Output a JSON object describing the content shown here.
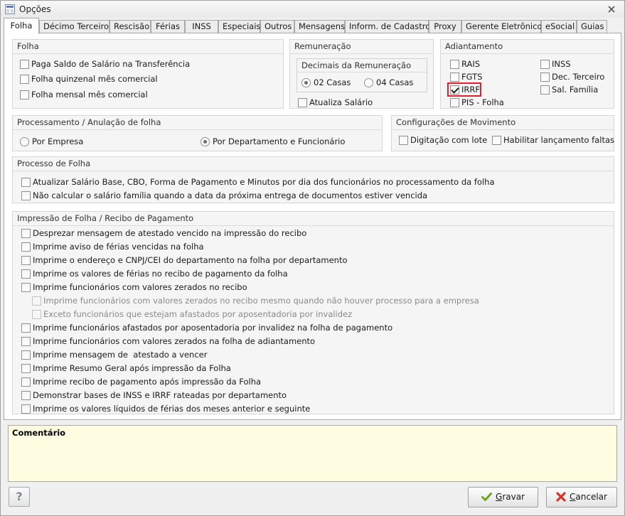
{
  "window": {
    "title": "Opções"
  },
  "tabs": [
    "Folha",
    "Décimo Terceiro",
    "Rescisão",
    "Férias",
    "INSS",
    "Especiais",
    "Outros",
    "Mensagens",
    "Inform. de Cadastro",
    "Proxy",
    "Gerente Eletrônico",
    "eSocial",
    "Guias"
  ],
  "active_tab": "Folha",
  "folha": {
    "title": "Folha",
    "options": [
      {
        "label": "Paga Saldo de Salário na Transferência",
        "checked": false
      },
      {
        "label": "Folha quinzenal mês comercial",
        "checked": false
      },
      {
        "label": "Folha mensal mês comercial",
        "checked": false
      }
    ]
  },
  "remuneracao": {
    "title": "Remuneração",
    "decimais_title": "Decimais da Remuneração",
    "radio_02": "02 Casas",
    "radio_04": "04 Casas",
    "selected": "02 Casas",
    "atualiza_salario": "Atualiza Salário"
  },
  "adiantamento": {
    "title": "Adiantamento",
    "left": [
      {
        "label": "RAIS",
        "checked": false
      },
      {
        "label": "FGTS",
        "checked": false
      },
      {
        "label": "IRRF",
        "checked": true
      },
      {
        "label": "PIS - Folha",
        "checked": false
      }
    ],
    "right": [
      {
        "label": "INSS",
        "checked": false
      },
      {
        "label": "Dec. Terceiro",
        "checked": false
      },
      {
        "label": "Sal. Família",
        "checked": false
      }
    ]
  },
  "processamento": {
    "title": "Processamento / Anulação de folha",
    "por_empresa": "Por Empresa",
    "por_departamento": "Por Departamento e Funcionário",
    "selected": "Por Departamento e Funcionário"
  },
  "movimento": {
    "title": "Configurações de Movimento",
    "digitacao": "Digitação com lote",
    "habilitar": "Habilitar lançamento faltas"
  },
  "processo": {
    "title": "Processo de Folha",
    "options": [
      "Atualizar Salário Base, CBO, Forma de Pagamento e Minutos por dia dos funcionários no processamento da folha",
      "Não calcular o salário família quando a data da próxima entrega de documentos estiver vencida"
    ]
  },
  "impressao": {
    "title": "Impressão de Folha / Recibo de Pagamento",
    "options": [
      {
        "label": "Desprezar mensagem de atestado vencido na impressão do recibo",
        "indent": false,
        "disabled": false
      },
      {
        "label": "Imprime aviso de férias vencidas na folha",
        "indent": false,
        "disabled": false
      },
      {
        "label": "Imprime o endereço e CNPJ/CEI do departamento na folha por departamento",
        "indent": false,
        "disabled": false
      },
      {
        "label": "Imprime os valores de férias no recibo de pagamento da folha",
        "indent": false,
        "disabled": false
      },
      {
        "label": "Imprime funcionários com valores zerados no recibo",
        "indent": false,
        "disabled": false
      },
      {
        "label": "Imprime funcionários com valores zerados no recibo mesmo quando não houver processo para a empresa",
        "indent": true,
        "disabled": true
      },
      {
        "label": "Exceto funcionários que estejam afastados por aposentadoria por invalidez",
        "indent": true,
        "disabled": true
      },
      {
        "label": "Imprime funcionários afastados por aposentadoria por invalidez na folha de pagamento",
        "indent": false,
        "disabled": false
      },
      {
        "label": "Imprime funcionários com valores zerados na folha de adiantamento",
        "indent": false,
        "disabled": false
      },
      {
        "label": "Imprime mensagem de  atestado a vencer",
        "indent": false,
        "disabled": false
      },
      {
        "label": "Imprime Resumo Geral após impressão da Folha",
        "indent": false,
        "disabled": false
      },
      {
        "label": "Imprime recibo de pagamento após impressão da Folha",
        "indent": false,
        "disabled": false
      },
      {
        "label": "Demonstrar bases de INSS e IRRF rateadas por departamento",
        "indent": false,
        "disabled": false
      },
      {
        "label": "Imprime os valores líquidos de férias dos meses anterior e seguinte",
        "indent": false,
        "disabled": false
      }
    ]
  },
  "comentario": {
    "label": "Comentário"
  },
  "buttons": {
    "help": "?",
    "gravar_hotkey": "G",
    "gravar_rest": "ravar",
    "cancelar_hotkey": "C",
    "cancelar_rest": "ancelar"
  },
  "colors": {
    "highlight": "#e0202a",
    "comment_bg": "#fffde1",
    "gravar_icon": "#6aa81e",
    "cancelar_icon": "#d0362a"
  }
}
